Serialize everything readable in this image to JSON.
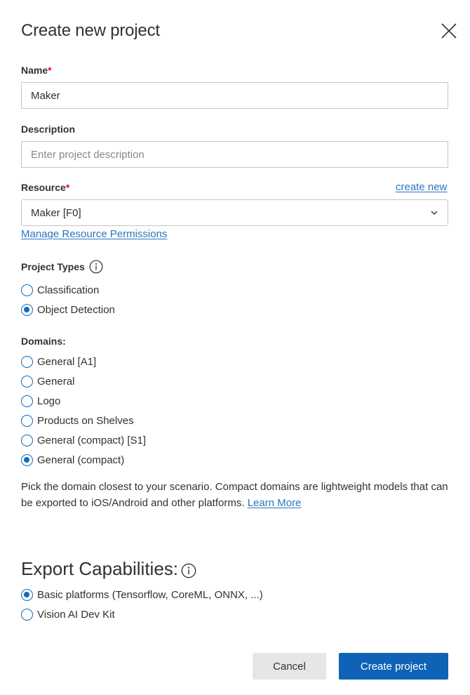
{
  "dialog": {
    "title": "Create new project",
    "close_icon": "close-icon"
  },
  "name_field": {
    "label": "Name",
    "required_mark": "*",
    "value": "Maker",
    "placeholder": ""
  },
  "description_field": {
    "label": "Description",
    "value": "",
    "placeholder": "Enter project description"
  },
  "resource_field": {
    "label": "Resource",
    "required_mark": "*",
    "create_new_link": "create new",
    "selected": "Maker [F0]",
    "chevron_icon": "chevron-down-icon",
    "manage_permissions_link": "Manage Resource Permissions"
  },
  "project_types": {
    "label": "Project Types",
    "info_icon": "info-icon",
    "options": [
      {
        "label": "Classification",
        "checked": false
      },
      {
        "label": "Object Detection",
        "checked": true
      }
    ]
  },
  "domains": {
    "label": "Domains:",
    "options": [
      {
        "label": "General [A1]",
        "checked": false
      },
      {
        "label": "General",
        "checked": false
      },
      {
        "label": "Logo",
        "checked": false
      },
      {
        "label": "Products on Shelves",
        "checked": false
      },
      {
        "label": "General (compact) [S1]",
        "checked": false
      },
      {
        "label": "General (compact)",
        "checked": true
      }
    ],
    "help_text": "Pick the domain closest to your scenario. Compact domains are lightweight models that can be exported to iOS/Android and other platforms.",
    "learn_more_link": "Learn More"
  },
  "export_capabilities": {
    "label": "Export Capabilities:",
    "info_icon": "info-icon",
    "options": [
      {
        "label": "Basic platforms (Tensorflow, CoreML, ONNX, ...)",
        "checked": true
      },
      {
        "label": "Vision AI Dev Kit",
        "checked": false
      }
    ]
  },
  "footer": {
    "cancel_label": "Cancel",
    "create_label": "Create project"
  },
  "colors": {
    "accent": "#0f6cbd",
    "primary_button": "#0f62b6",
    "link": "#2b73c2",
    "required": "#e00b1c"
  }
}
